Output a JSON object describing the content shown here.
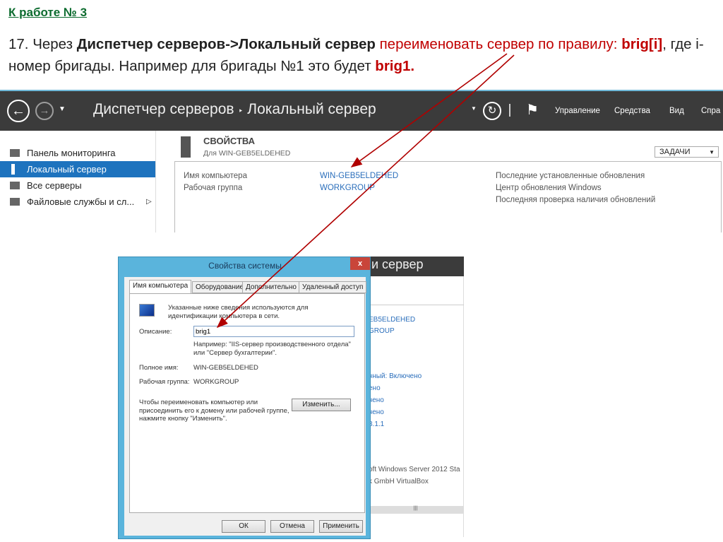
{
  "slide": {
    "heading": "К работе № 3",
    "task_prefix": "17. Через ",
    "task_bold": "Диспетчер серверов->Локальный сервер",
    "task_red1": " переименовать сервер по правилу: ",
    "task_brig": "brig[i]",
    "task_mid": ", где i-номер бригады. Например для бригады №1 это будет ",
    "task_brig1": "brig1."
  },
  "server_manager": {
    "title": "Диспетчер серверов",
    "breadcrumb_sep": "‣",
    "page": "Локальный сервер",
    "menu": [
      "Управление",
      "Средства",
      "Вид",
      "Спра"
    ],
    "sidebar": [
      "Панель мониторинга",
      "Локальный сервер",
      "Все серверы",
      "Файловые службы и сл..."
    ],
    "properties_title": "СВОЙСТВА",
    "properties_sub": "Для WIN-GEB5ELDEHED",
    "tasks": "ЗАДАЧИ",
    "rows": [
      {
        "label": "Имя компьютера",
        "value": "WIN-GEB5ELDEHED"
      },
      {
        "label": "Рабочая группа",
        "value": "WORKGROUP"
      }
    ],
    "right_labels": [
      "Последние установленные обновления",
      "Центр обновления Windows",
      "Последняя проверка наличия обновлений"
    ]
  },
  "background_window": {
    "title_fragment": "и сервер",
    "values": [
      "EB5ELDEHED",
      "GROUP",
      "чный: Включено",
      "ено",
      "чено",
      "чено",
      "8.1.1",
      "oft Windows Server 2012 Sta",
      "k GmbH VirtualBox"
    ]
  },
  "dialog": {
    "title": "Свойства системы",
    "close": "x",
    "tabs": [
      "Имя компьютера",
      "Оборудование",
      "Дополнительно",
      "Удаленный доступ"
    ],
    "info": "Указанные ниже сведения используются для идентификации компьютера в сети.",
    "desc_label": "Описание:",
    "desc_value": "brig1",
    "example": "Например: \"IIS-сервер производственного отдела\" или \"Сервер бухгалтерии\".",
    "fullname_label": "Полное имя:",
    "fullname_value": "WIN-GEB5ELDEHED",
    "workgroup_label": "Рабочая группа:",
    "workgroup_value": "WORKGROUP",
    "rename_text": "Чтобы переименовать компьютер или присоединить его к домену или рабочей группе, нажмите кнопку \"Изменить\".",
    "change": "Изменить...",
    "ok": "ОК",
    "cancel": "Отмена",
    "apply": "Применить"
  },
  "colors": {
    "arrow": "#b00000",
    "accent": "#1e73be",
    "header": "#3b3b3b"
  }
}
